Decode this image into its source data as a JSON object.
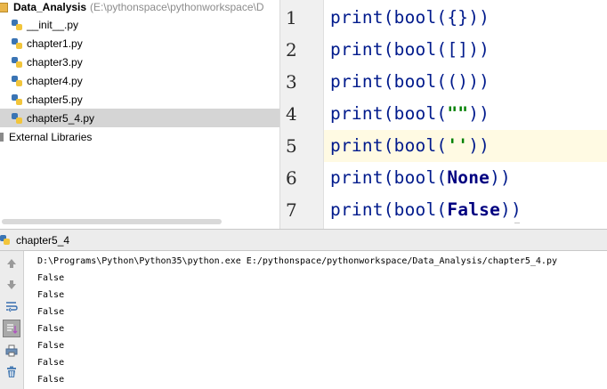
{
  "project": {
    "root_name": "Data_Analysis",
    "root_path": "(E:\\pythonspace\\pythonworkspace\\D",
    "files": [
      "__init__.py",
      "chapter1.py",
      "chapter3.py",
      "chapter4.py",
      "chapter5.py",
      "chapter5_4.py"
    ],
    "selected_file": "chapter5_4.py",
    "external_libraries": "External Libraries"
  },
  "editor": {
    "line_numbers": [
      "1",
      "2",
      "3",
      "4",
      "5",
      "6",
      "7"
    ],
    "current_line": "5",
    "lines": [
      {
        "prefix": "print(bool(",
        "arg": "{}",
        "suffix": "))"
      },
      {
        "prefix": "print(bool(",
        "arg": "[]",
        "suffix": "))"
      },
      {
        "prefix": "print(bool(",
        "arg": "()",
        "suffix": "))"
      },
      {
        "prefix": "print(bool(",
        "arg": "\"\"",
        "suffix": "))"
      },
      {
        "prefix": "print(bool(",
        "arg": "''",
        "suffix": "))"
      },
      {
        "prefix": "print(bool(",
        "arg": "None",
        "suffix": "))"
      },
      {
        "prefix": "print(bool(",
        "arg": "False",
        "suffix": "))"
      }
    ]
  },
  "run": {
    "tab_label": "chapter5_4",
    "toolbar_icons": [
      "arrow-up-icon",
      "arrow-down-icon",
      "soft-wrap-icon",
      "scroll-to-end-icon",
      "print-icon",
      "trash-icon"
    ],
    "command": "D:\\Programs\\Python\\Python35\\python.exe E:/pythonspace/pythonworkspace/Data_Analysis/chapter5_4.py",
    "output": [
      "False",
      "False",
      "False",
      "False",
      "False",
      "False",
      "False"
    ]
  }
}
